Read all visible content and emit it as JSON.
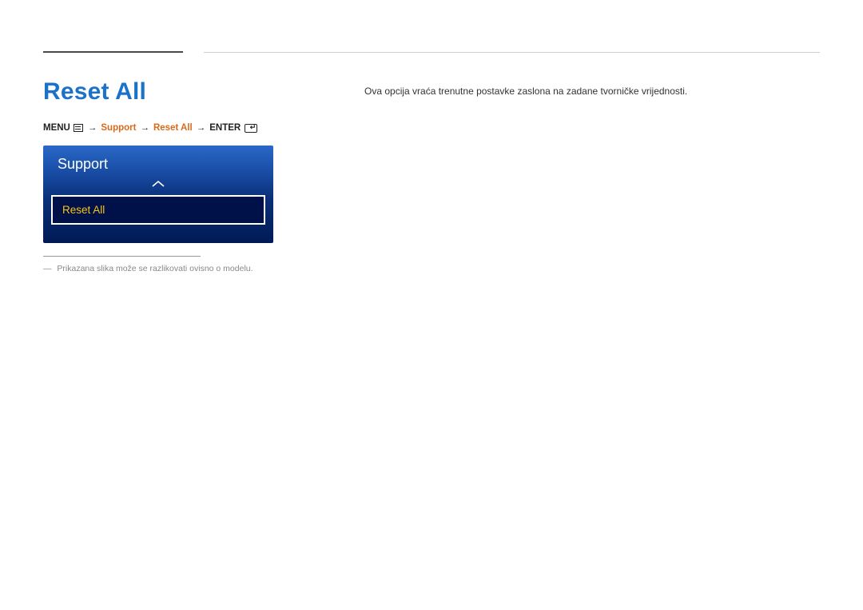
{
  "title": "Reset All",
  "description": "Ova opcija vraća trenutne postavke zaslona na zadane tvorničke vrijednosti.",
  "breadcrumb": {
    "menu_label": "MENU",
    "path1": "Support",
    "path2": "Reset All",
    "enter_label": "ENTER"
  },
  "osd": {
    "header": "Support",
    "selected_item": "Reset All"
  },
  "footnote": {
    "dash": "―",
    "text": "Prikazana slika može se razlikovati ovisno o modelu."
  }
}
